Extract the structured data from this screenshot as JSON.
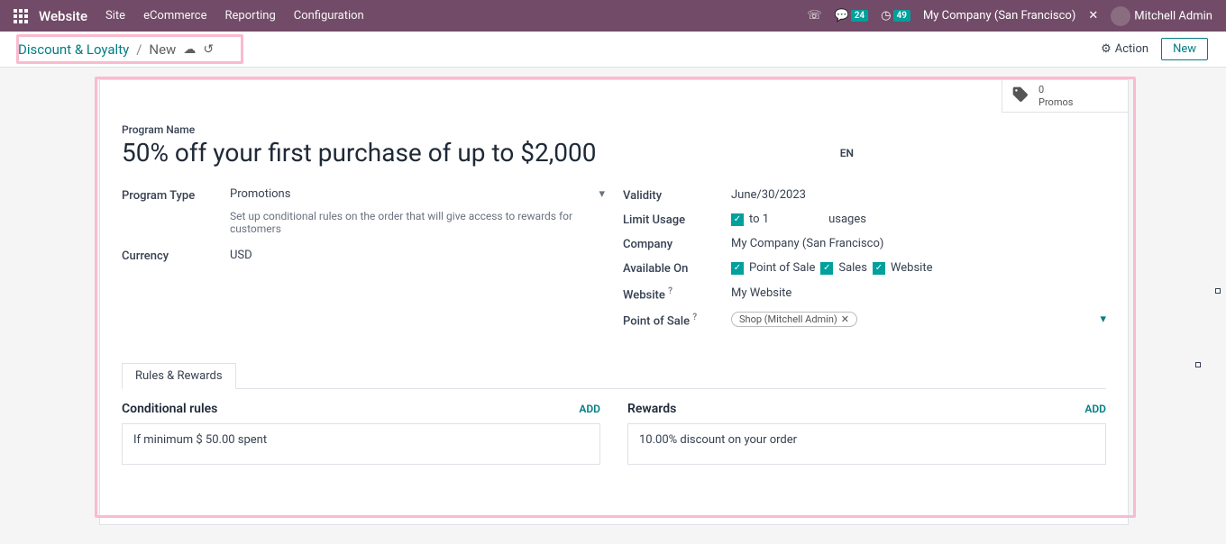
{
  "nav": {
    "brand": "Website",
    "items": [
      "Site",
      "eCommerce",
      "Reporting",
      "Configuration"
    ],
    "messages_count": "24",
    "activities_count": "49",
    "company": "My Company (San Francisco)",
    "user": "Mitchell Admin"
  },
  "controlbar": {
    "breadcrumb_root": "Discount & Loyalty",
    "breadcrumb_current": "New",
    "action_label": "Action",
    "new_label": "New"
  },
  "stat": {
    "count": "0",
    "label": "Promos"
  },
  "form": {
    "program_name_label": "Program Name",
    "program_name": "50% off your first purchase of up to $2,000",
    "lang": "EN",
    "program_type_label": "Program Type",
    "program_type": "Promotions",
    "program_type_desc": "Set up conditional rules on the order that will give access to rewards for customers",
    "currency_label": "Currency",
    "currency": "USD",
    "validity_label": "Validity",
    "validity": "June/30/2023",
    "limit_usage_label": "Limit Usage",
    "limit_to": "to 1",
    "limit_usages": "usages",
    "company_label": "Company",
    "company": "My Company (San Francisco)",
    "available_on_label": "Available On",
    "available_on": [
      "Point of Sale",
      "Sales",
      "Website"
    ],
    "website_label": "Website",
    "website": "My Website",
    "pos_label": "Point of Sale",
    "pos_tag": "Shop (Mitchell Admin)"
  },
  "tabs": {
    "rules_rewards": "Rules & Rewards"
  },
  "rules": {
    "title": "Conditional rules",
    "add": "ADD",
    "item": "If minimum $ 50.00 spent"
  },
  "rewards": {
    "title": "Rewards",
    "add": "ADD",
    "item": "10.00% discount on your order"
  }
}
